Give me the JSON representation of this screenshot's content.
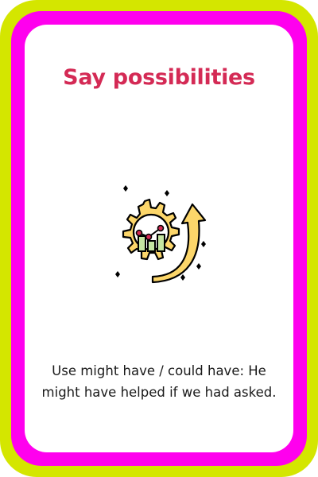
{
  "card": {
    "title": "Say possibilities",
    "description": "Use might have / could have: He might have helped if we had asked.",
    "illustration_icon": "growth-chart-gear-icon"
  },
  "colors": {
    "outer_border": "#d4e600",
    "inner_border": "#ff00ee",
    "title": "#d42a55",
    "icon_yellow": "#fcd66a",
    "icon_green": "#c5e6a2",
    "icon_red": "#d42a55"
  }
}
